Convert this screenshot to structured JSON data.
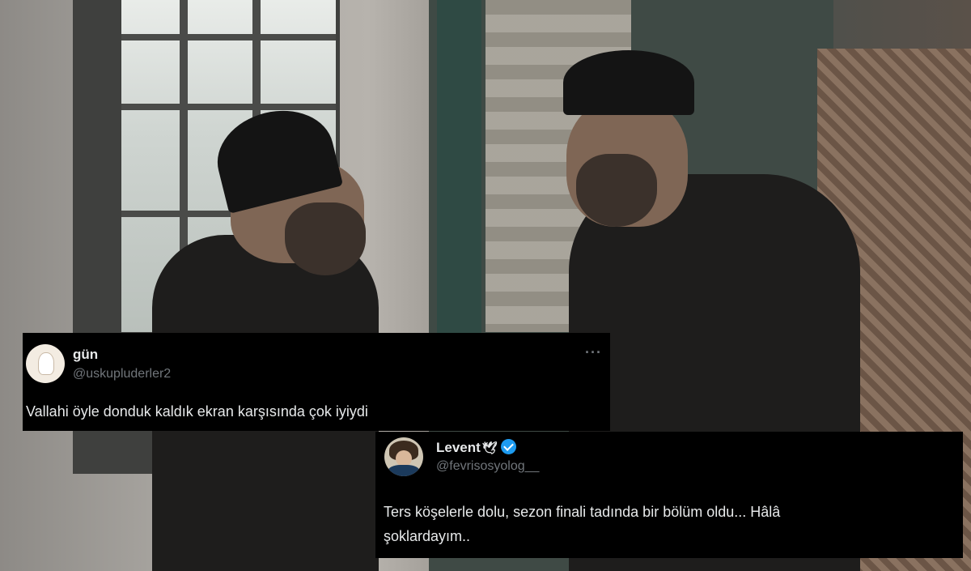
{
  "tweets": [
    {
      "display_name": "gün",
      "handle": "@uskupluderler2",
      "text": "Vallahi öyle donduk kaldık ekran karşısında çok iyiydi",
      "more_icon": "···"
    },
    {
      "display_name": "Levent",
      "name_emoji": "🕊",
      "verified": true,
      "handle": "@fevrisosyolog__",
      "text_line1": "Ters köşelerle dolu, sezon finali tadında bir bölüm oldu... Hâlâ",
      "text_line2": "şoklardayım.."
    }
  ],
  "colors": {
    "tweet_bg": "#000000",
    "text_primary": "#e7e9ea",
    "text_secondary": "#71767b",
    "verified_blue": "#1d9bf0"
  }
}
